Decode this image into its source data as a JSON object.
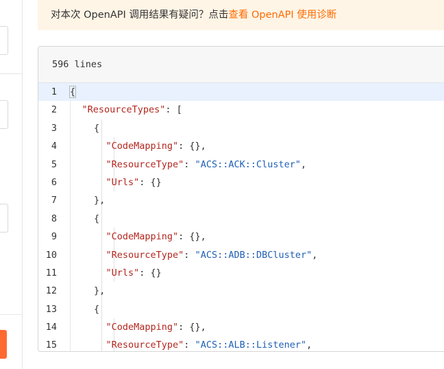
{
  "notice": {
    "prefix": "对本次 OpenAPI 调用结果有疑问？点击",
    "link": "查看 OpenAPI 使用诊断"
  },
  "panel": {
    "line_count": "596 lines"
  },
  "code_lines": [
    {
      "n": "1",
      "indent": 0,
      "tokens": [
        {
          "t": "{",
          "c": "cursor-brace"
        }
      ]
    },
    {
      "n": "2",
      "indent": 1,
      "tokens": [
        {
          "t": "\"ResourceTypes\"",
          "c": "k"
        },
        {
          "t": ": ["
        }
      ]
    },
    {
      "n": "3",
      "indent": 2,
      "tokens": [
        {
          "t": "{"
        }
      ]
    },
    {
      "n": "4",
      "indent": 3,
      "tokens": [
        {
          "t": "\"CodeMapping\"",
          "c": "k"
        },
        {
          "t": ": {},"
        }
      ]
    },
    {
      "n": "5",
      "indent": 3,
      "tokens": [
        {
          "t": "\"ResourceType\"",
          "c": "k"
        },
        {
          "t": ": "
        },
        {
          "t": "\"ACS::ACK::Cluster\"",
          "c": "s"
        },
        {
          "t": ","
        }
      ]
    },
    {
      "n": "6",
      "indent": 3,
      "tokens": [
        {
          "t": "\"Urls\"",
          "c": "k"
        },
        {
          "t": ": {}"
        }
      ]
    },
    {
      "n": "7",
      "indent": 2,
      "tokens": [
        {
          "t": "},"
        }
      ]
    },
    {
      "n": "8",
      "indent": 2,
      "tokens": [
        {
          "t": "{"
        }
      ]
    },
    {
      "n": "9",
      "indent": 3,
      "tokens": [
        {
          "t": "\"CodeMapping\"",
          "c": "k"
        },
        {
          "t": ": {},"
        }
      ]
    },
    {
      "n": "10",
      "indent": 3,
      "tokens": [
        {
          "t": "\"ResourceType\"",
          "c": "k"
        },
        {
          "t": ": "
        },
        {
          "t": "\"ACS::ADB::DBCluster\"",
          "c": "s"
        },
        {
          "t": ","
        }
      ]
    },
    {
      "n": "11",
      "indent": 3,
      "tokens": [
        {
          "t": "\"Urls\"",
          "c": "k"
        },
        {
          "t": ": {}"
        }
      ]
    },
    {
      "n": "12",
      "indent": 2,
      "tokens": [
        {
          "t": "},"
        }
      ]
    },
    {
      "n": "13",
      "indent": 2,
      "tokens": [
        {
          "t": "{"
        }
      ]
    },
    {
      "n": "14",
      "indent": 3,
      "tokens": [
        {
          "t": "\"CodeMapping\"",
          "c": "k"
        },
        {
          "t": ": {},"
        }
      ]
    },
    {
      "n": "15",
      "indent": 3,
      "tokens": [
        {
          "t": "\"ResourceType\"",
          "c": "k"
        },
        {
          "t": ": "
        },
        {
          "t": "\"ACS::ALB::Listener\"",
          "c": "s"
        },
        {
          "t": ","
        }
      ]
    }
  ],
  "colors": {
    "accent": "#ff6a00",
    "notice_bg": "#fff5e6",
    "json_key": "#b3261e",
    "json_string": "#1f5fb5",
    "active_line": "#e8f1fd"
  }
}
